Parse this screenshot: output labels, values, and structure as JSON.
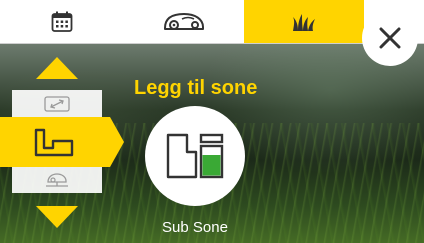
{
  "tabs": [
    {
      "name": "calendar",
      "icon": "calendar-icon",
      "active": false
    },
    {
      "name": "mower",
      "icon": "mower-icon",
      "active": false
    },
    {
      "name": "garden",
      "icon": "grass-icon",
      "active": true
    }
  ],
  "close_icon": "close-icon",
  "colors": {
    "accent": "#ffd400",
    "zone_fill": "#3aa935",
    "icon_stroke": "#333333"
  },
  "title": "Legg til sone",
  "zone": {
    "label": "Sub Sone",
    "icon": "sub-zone-icon"
  },
  "selector": {
    "up_icon": "arrow-up-icon",
    "down_icon": "arrow-down-icon",
    "items": [
      {
        "icon": "resize-zone-icon",
        "state": "inactive"
      },
      {
        "icon": "zone-shape-icon",
        "state": "active"
      },
      {
        "icon": "mower-on-wire-icon",
        "state": "inactive"
      }
    ]
  }
}
